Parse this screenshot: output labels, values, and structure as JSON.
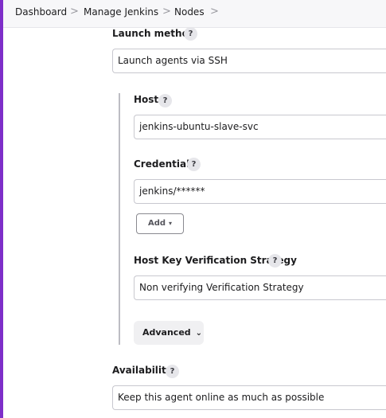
{
  "breadcrumb": {
    "items": [
      "Dashboard",
      "Manage Jenkins",
      "Nodes"
    ],
    "separator": ">"
  },
  "launch_method": {
    "label": "Launch method",
    "help": "?",
    "value": "Launch agents via SSH"
  },
  "host": {
    "label": "Host",
    "help": "?",
    "value": "jenkins-ubuntu-slave-svc"
  },
  "credentials": {
    "label": "Credentials",
    "help": "?",
    "value": "jenkins/******",
    "add_label": "Add",
    "add_caret": "▾"
  },
  "host_key": {
    "label": "Host Key Verification Strategy",
    "help": "?",
    "value": "Non verifying Verification Strategy"
  },
  "advanced": {
    "label": "Advanced",
    "chevron": "⌄"
  },
  "availability": {
    "label": "Availability",
    "help": "?",
    "value": "Keep this agent online as much as possible"
  },
  "colors": {
    "accent": "#7e2ec9",
    "nested_line": "#bdbdc3"
  }
}
